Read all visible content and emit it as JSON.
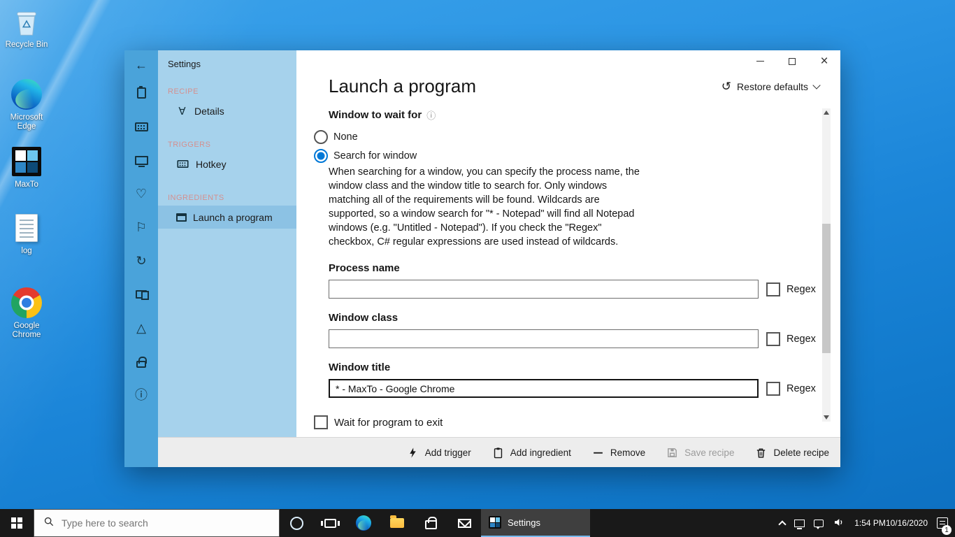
{
  "desktop": {
    "icons": [
      {
        "label": "Recycle Bin"
      },
      {
        "label": "Microsoft Edge"
      },
      {
        "label": "MaxTo"
      },
      {
        "label": "log"
      },
      {
        "label": "Google Chrome"
      }
    ]
  },
  "window": {
    "sidebar": {
      "title": "Settings",
      "sections": [
        {
          "header": "RECIPE",
          "items": [
            {
              "label": "Details"
            }
          ]
        },
        {
          "header": "TRIGGERS",
          "items": [
            {
              "label": "Hotkey"
            }
          ]
        },
        {
          "header": "INGREDIENTS",
          "items": [
            {
              "label": "Launch a program"
            }
          ]
        }
      ]
    },
    "page": {
      "title": "Launch a program",
      "restore_defaults_label": "Restore defaults",
      "section_label": "Window to wait for",
      "radios": [
        {
          "label": "None",
          "selected": false
        },
        {
          "label": "Search for window",
          "selected": true
        }
      ],
      "description": "When searching for a window, you can specify the process name, the window class and the window title to search for. Only windows matching all of the requirements will be found. Wildcards are supported, so a window search for \"* - Notepad\" will find all Notepad windows (e.g. \"Untitled - Notepad\"). If you check the \"Regex\" checkbox, C# regular expressions are used instead of wildcards.",
      "fields": [
        {
          "label": "Process name",
          "value": "",
          "checkbox": "Regex"
        },
        {
          "label": "Window class",
          "value": "",
          "checkbox": "Regex"
        },
        {
          "label": "Window title",
          "value": "* - MaxTo - Google Chrome",
          "checkbox": "Regex"
        }
      ],
      "exit_checkbox_label": "Wait for program to exit"
    },
    "command_bar": {
      "add_trigger": "Add trigger",
      "add_ingredient": "Add ingredient",
      "remove": "Remove",
      "save_recipe": "Save recipe",
      "delete_recipe": "Delete recipe"
    }
  },
  "taskbar": {
    "search_placeholder": "Type here to search",
    "active_task_label": "Settings",
    "tray": {
      "time": "1:54 PM",
      "date": "10/16/2020",
      "badge": "1"
    }
  },
  "icons": {
    "back": "←",
    "undo": "↺",
    "info": "ⓘ",
    "details": "∀",
    "heart": "♡",
    "flag": "⚐",
    "refresh": "↻",
    "warning": "△",
    "close": "×"
  }
}
